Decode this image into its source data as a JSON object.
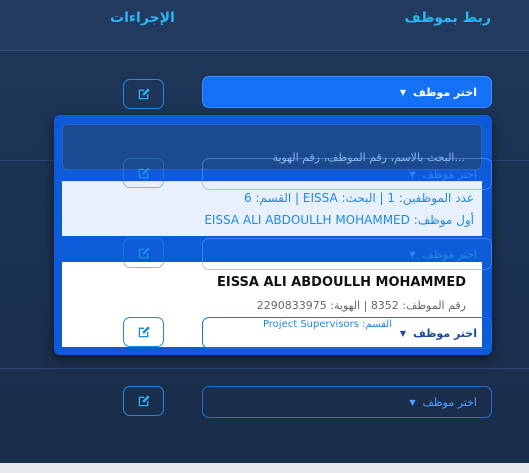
{
  "header": {
    "link_title": "ربط بموظف",
    "actions_title": "الإجراءات"
  },
  "select_placeholder": "اختر موظف",
  "dropdown": {
    "search_placeholder": "البحث بالاسم، رقم الموظف، رقم الهوية...",
    "info_count": "عدد الموظفين: 1 | البحث: EISSA | القسم: 6",
    "info_first": "أول موظف: EISSA ALI ABDOULLH MOHAMMED",
    "result": {
      "name": "EISSA ALI ABDOULLH MOHAMMED",
      "meta": "رقم الموظف: 8352 | الهوية: 2290833975",
      "department": "القسم: Project Supervisors"
    }
  },
  "icons": {
    "edit": "edit-pencil-icon",
    "caret": "caret-down-icon"
  },
  "colors": {
    "accent": "#29b6f6",
    "active_select": "#1470f5",
    "dropdown": "#0d5bd8"
  }
}
